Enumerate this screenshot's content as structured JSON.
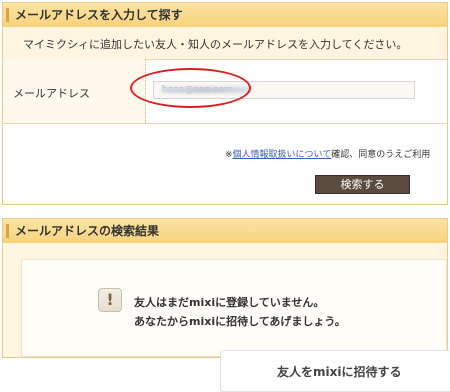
{
  "search_panel": {
    "title": "メールアドレスを入力して探す",
    "instruction": "マイミクシィに追加したい友人・知人のメールアドレスを入力してください。",
    "email_label": "メールアドレス",
    "email_value": "hana@ann.com",
    "privacy_prefix": "※",
    "privacy_link": "個人情報取扱いについて",
    "privacy_suffix": "確認、同意のうえご利用",
    "search_button": "検索する"
  },
  "results_panel": {
    "title": "メールアドレスの検索結果",
    "alert_icon": "exclamation-icon",
    "alert_glyph": "!",
    "message_line1": "友人はまだmixiに登録していません。",
    "message_line2": "あなたからmixiに招待してあげましょう。",
    "invite_button": "友人をmixiに招待する"
  },
  "colors": {
    "header_bg": "#f6d27c",
    "highlight_ring": "#d82020",
    "button_bg": "#5b4a40",
    "link": "#2d63b8"
  }
}
